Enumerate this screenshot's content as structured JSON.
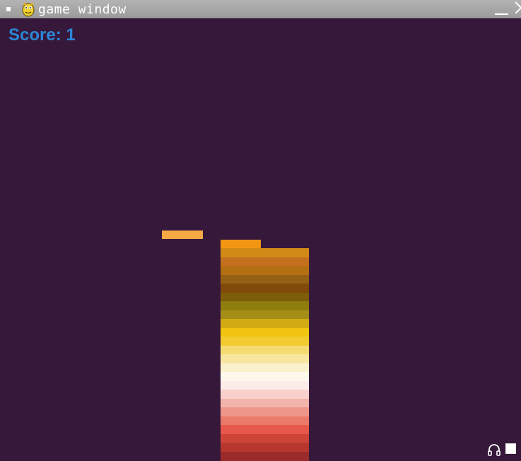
{
  "window": {
    "title": "game window",
    "icon": "pygame-snake-icon"
  },
  "hud": {
    "score_label": "Score: 1",
    "score_color": "#2d87d6"
  },
  "game": {
    "background": "#36183b",
    "moving_block_color": "#f7a944",
    "top_block_color": "#f29713",
    "stack_colors": [
      "#d28a17",
      "#c36f1d",
      "#b46f13",
      "#946015",
      "#7f4a0a",
      "#7d5d0a",
      "#8f7d0e",
      "#a58e17",
      "#d2ab14",
      "#f1c50f",
      "#f1cb30",
      "#f4dc72",
      "#f8e5a0",
      "#fbf1cc",
      "#fdf8ea",
      "#fcebe9",
      "#f9d0cb",
      "#f2b4aa",
      "#ef968a",
      "#eb7a6a",
      "#e7584a",
      "#ce4439",
      "#b7372f",
      "#9a2b2a"
    ]
  },
  "corner_icons": [
    "headphones-icon",
    "fullscreen-icon"
  ]
}
